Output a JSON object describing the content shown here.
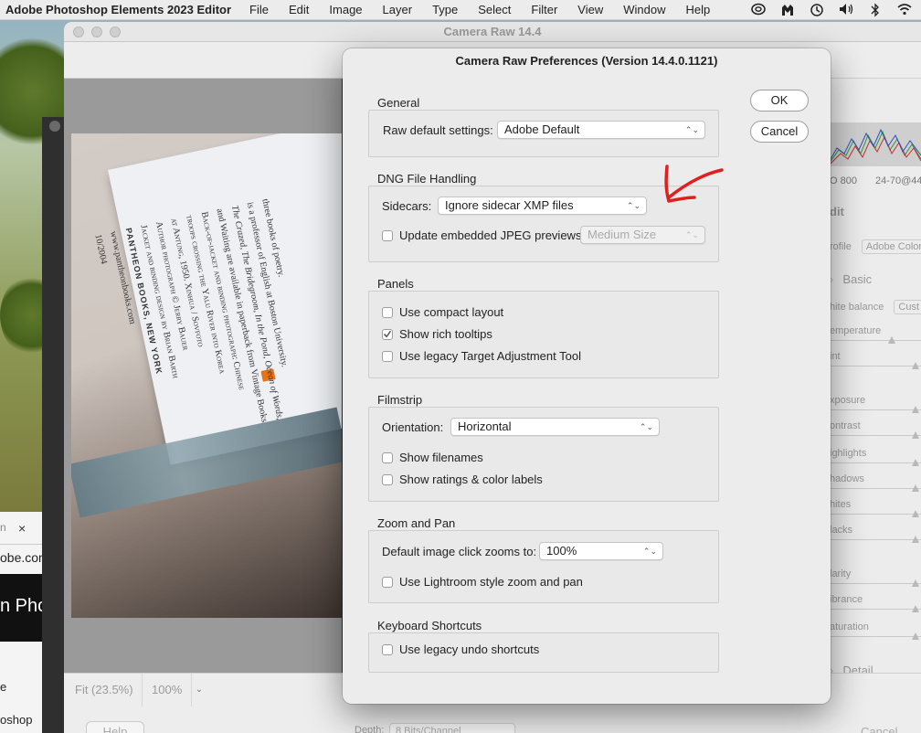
{
  "menubar": {
    "app_name": "Adobe Photoshop Elements 2023 Editor",
    "items": [
      "File",
      "Edit",
      "Image",
      "Layer",
      "Type",
      "Select",
      "Filter",
      "View",
      "Window",
      "Help"
    ],
    "tray_icons": [
      "creative-cloud-icon",
      "malwarebytes-icon",
      "time-machine-icon",
      "volume-icon",
      "bluetooth-icon",
      "wifi-icon"
    ]
  },
  "browser": {
    "tab_fragment": "n",
    "close_glyph": "×",
    "url_fragment": "obe.com",
    "banner_text": "n Phot",
    "line1": "e",
    "line2": "oshop",
    "bottom_fragment": "Pho"
  },
  "camera_raw": {
    "title": "Camera Raw 14.4",
    "zoom_fit": "Fit (23.5%)",
    "zoom_pct": "100%",
    "help_button": "Help",
    "depth_label": "Depth:",
    "depth_value": "8 Bits/Channel",
    "cancel_bottom": "Cancel",
    "right_panel": {
      "iso": "O 800",
      "lens": "24-70@44",
      "edit_label": "dit",
      "profile_label": "rofile",
      "profile_value": "Adobe Color",
      "basic": "Basic",
      "white_balance": "hite balance",
      "wb_value": "Cust",
      "sliders": [
        "emperature",
        "int",
        "xposure",
        "ontrast",
        "ighlights",
        "hadows",
        "hites",
        "lacks",
        "larity",
        "ibrance",
        "aturation"
      ],
      "detail": "Detail",
      "sharpening": "harpening"
    }
  },
  "book": {
    "lines": [
      "three books of poetry.",
      "is a professor of English at Boston University.",
      "The Crazed, The Bridegroom, In the Pond, Ocean of Words,",
      "and Waiting are available in paperback from Vintage Books.",
      "Back-of-jacket and binding photograph: Chinese",
      "troops crossing the Yalu River into Korea",
      "at Antung, 1950. Xinhua / Sovfoto",
      "Author photograph © Jerry Bauer",
      "Jacket and binding design by Brian Barth"
    ],
    "publisher": "PANTHEON BOOKS, NEW YORK",
    "url": "www.pantheonbooks.com",
    "date": "10/2004"
  },
  "prefs": {
    "title": "Camera Raw Preferences  (Version 14.4.0.1121)",
    "ok": "OK",
    "cancel": "Cancel",
    "general": {
      "label": "General",
      "raw_default_label": "Raw default settings:",
      "raw_default_value": "Adobe Default"
    },
    "dng": {
      "label": "DNG File Handling",
      "sidecars_label": "Sidecars:",
      "sidecars_value": "Ignore sidecar XMP files",
      "update_jpeg_label": "Update embedded JPEG previews:",
      "update_jpeg_checked": false,
      "preview_size_value": "Medium Size"
    },
    "panels": {
      "label": "Panels",
      "compact": {
        "label": "Use compact layout",
        "checked": false
      },
      "tooltips": {
        "label": "Show rich tooltips",
        "checked": true
      },
      "legacy_tat": {
        "label": "Use legacy Target Adjustment Tool",
        "checked": false
      }
    },
    "filmstrip": {
      "label": "Filmstrip",
      "orientation_label": "Orientation:",
      "orientation_value": "Horizontal",
      "filenames": {
        "label": "Show filenames",
        "checked": false
      },
      "ratings": {
        "label": "Show ratings & color labels",
        "checked": false
      }
    },
    "zoom": {
      "label": "Zoom and Pan",
      "default_zoom_label": "Default image click zooms to:",
      "default_zoom_value": "100%",
      "lightroom": {
        "label": "Use Lightroom style zoom and pan",
        "checked": false
      }
    },
    "keyboard": {
      "label": "Keyboard Shortcuts",
      "legacy_undo": {
        "label": "Use legacy undo shortcuts",
        "checked": false
      }
    }
  },
  "colors": {
    "annotation_arrow": "#e0201f",
    "dialog_bg": "#ececec"
  }
}
